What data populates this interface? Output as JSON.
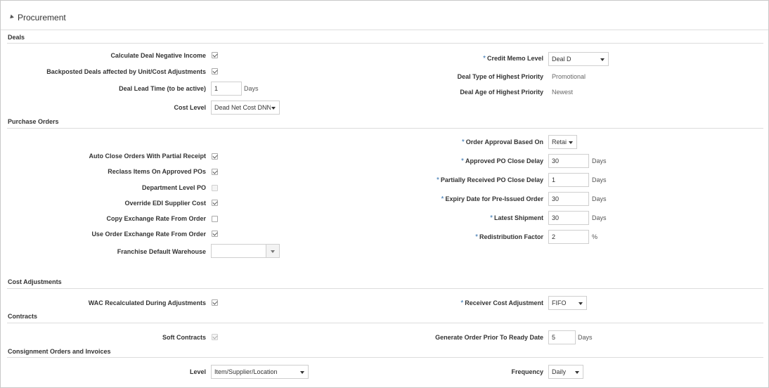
{
  "panel": {
    "title": "Procurement"
  },
  "deals": {
    "section_title": "Deals",
    "calc_deal_neg_income": {
      "label": "Calculate Deal Negative Income",
      "checked": true
    },
    "backposted_deals": {
      "label": "Backposted Deals affected by Unit/Cost Adjustments",
      "checked": true
    },
    "deal_lead_time": {
      "label": "Deal Lead Time (to be active)",
      "value": "1",
      "unit": "Days"
    },
    "cost_level": {
      "label": "Cost Level",
      "value": "Dead Net Cost DNN"
    },
    "credit_memo_level": {
      "label": "Credit Memo Level",
      "value": "Deal D"
    },
    "deal_type_highest_priority": {
      "label": "Deal Type of Highest Priority",
      "value": "Promotional"
    },
    "deal_age_highest_priority": {
      "label": "Deal Age of Highest Priority",
      "value": "Newest"
    }
  },
  "purchase_orders": {
    "section_title": "Purchase Orders",
    "auto_close_orders": {
      "label": "Auto Close Orders With Partial Receipt",
      "checked": true
    },
    "reclass_items": {
      "label": "Reclass Items On Approved POs",
      "checked": true
    },
    "department_level_po": {
      "label": "Department Level PO",
      "checked": false
    },
    "override_edi": {
      "label": "Override EDI Supplier Cost",
      "checked": true
    },
    "copy_exchange_rate": {
      "label": "Copy Exchange Rate From Order",
      "checked": false
    },
    "use_order_exchange_rate": {
      "label": "Use Order Exchange Rate From Order",
      "checked": true
    },
    "franchise_default_warehouse": {
      "label": "Franchise Default Warehouse",
      "value": ""
    },
    "order_approval_based_on": {
      "label": "Order Approval Based On",
      "value": "Retai"
    },
    "approved_po_close_delay": {
      "label": "Approved PO Close Delay",
      "value": "30",
      "unit": "Days"
    },
    "partially_received_po_close_delay": {
      "label": "Partially Received PO Close Delay",
      "value": "1",
      "unit": "Days"
    },
    "expiry_date_pre_issued": {
      "label": "Expiry Date for Pre-Issued Order",
      "value": "30",
      "unit": "Days"
    },
    "latest_shipment": {
      "label": "Latest Shipment",
      "value": "30",
      "unit": "Days"
    },
    "redistribution_factor": {
      "label": "Redistribution Factor",
      "value": "2",
      "unit": "%"
    }
  },
  "cost_adjustments": {
    "section_title": "Cost Adjustments",
    "wac_recalculated": {
      "label": "WAC Recalculated During Adjustments",
      "checked": true
    },
    "receiver_cost_adjustment": {
      "label": "Receiver Cost Adjustment",
      "value": "FIFO"
    }
  },
  "contracts": {
    "section_title": "Contracts",
    "soft_contracts": {
      "label": "Soft Contracts",
      "checked": true
    },
    "generate_order_prior": {
      "label": "Generate Order Prior To Ready Date",
      "value": "5",
      "unit": "Days"
    }
  },
  "consignment": {
    "section_title": "Consignment Orders and Invoices",
    "level": {
      "label": "Level",
      "value": "Item/Supplier/Location"
    },
    "frequency": {
      "label": "Frequency",
      "value": "Daily"
    }
  },
  "required_marker": "*",
  "colors": {
    "required": "#2f6fad",
    "border": "#cfcfcf",
    "section_line": "#dcdcdc"
  }
}
